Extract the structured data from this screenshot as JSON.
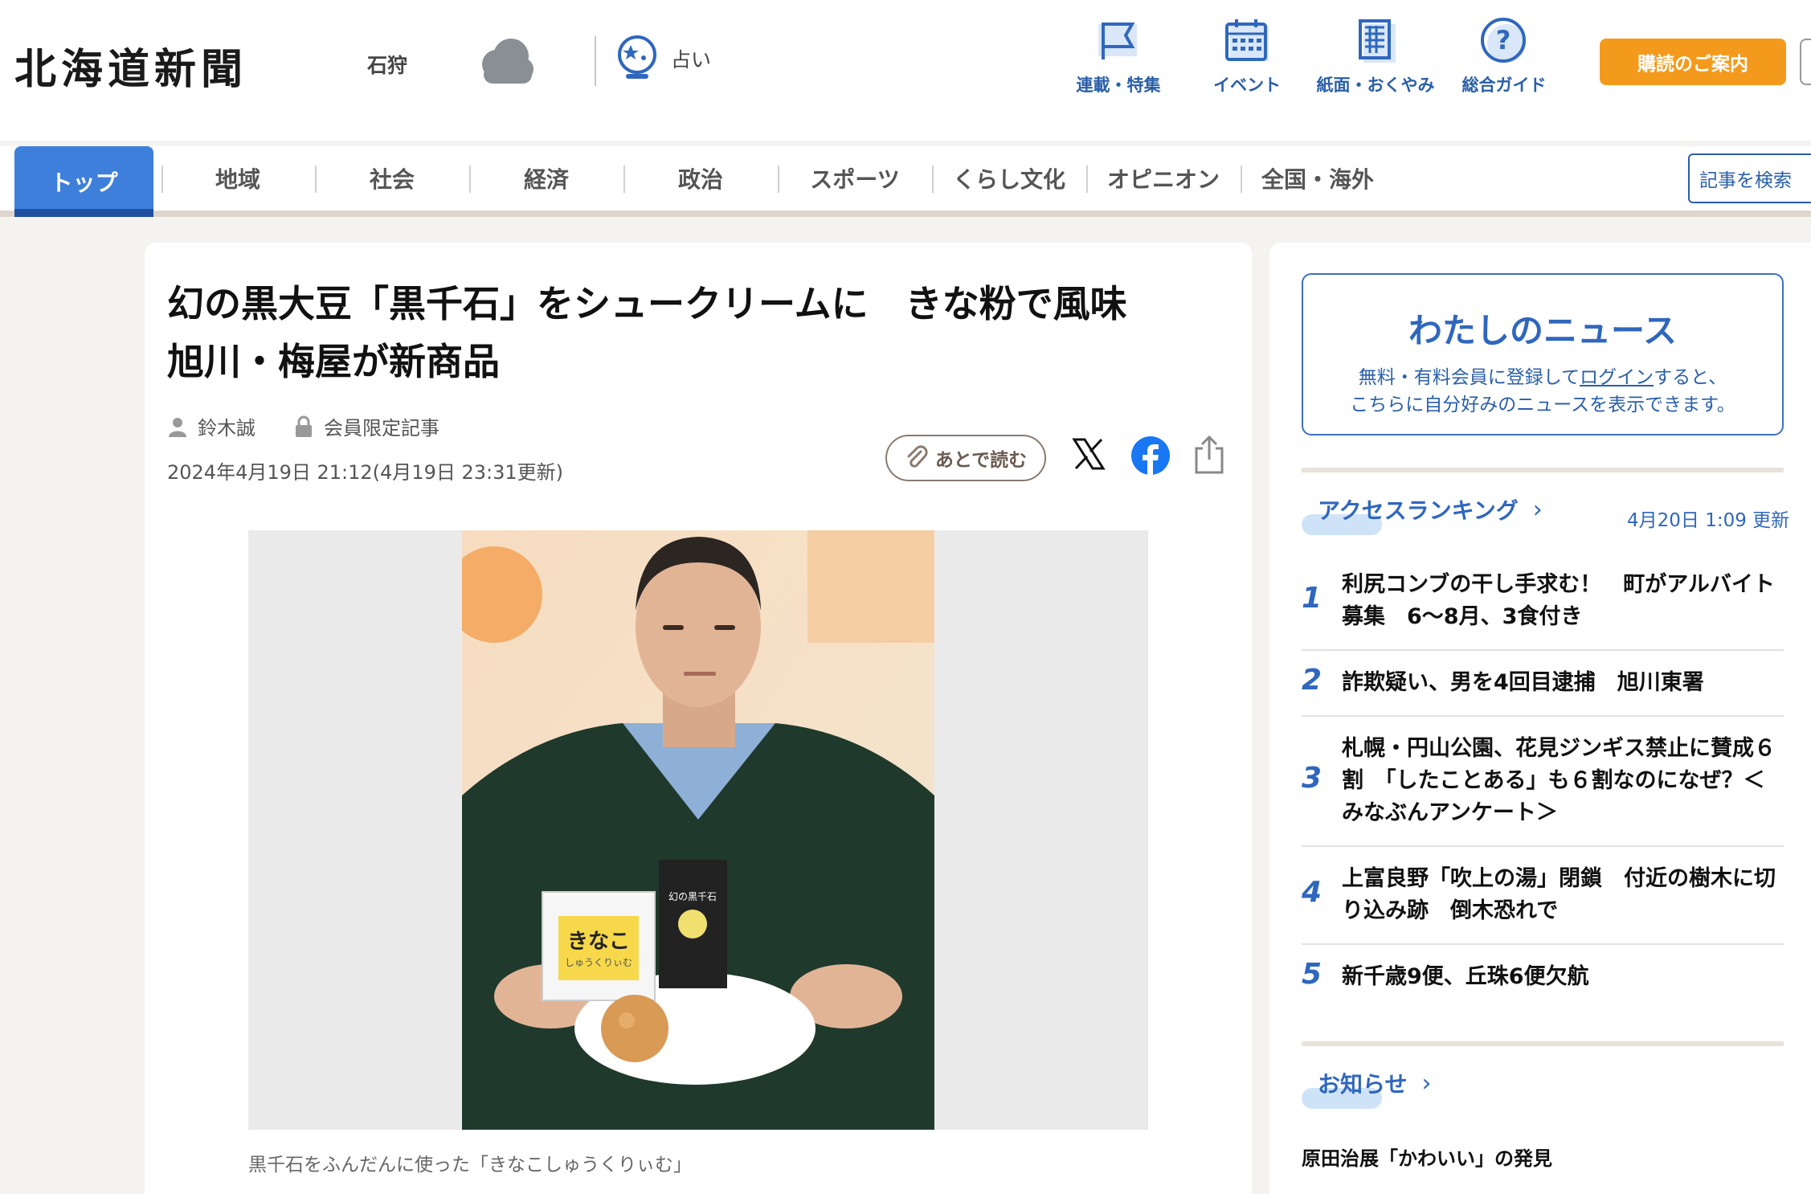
{
  "header": {
    "logo": "北海道新聞",
    "region": "石狩",
    "weather_icon": "cloud-icon",
    "fortune_label": "占い",
    "icons": [
      {
        "name": "flag-icon",
        "label": "連載・特集"
      },
      {
        "name": "calendar-icon",
        "label": "イベント"
      },
      {
        "name": "newspaper-icon",
        "label": "紙面・おくやみ"
      },
      {
        "name": "question-icon",
        "label": "総合ガイド"
      }
    ],
    "subscribe_label": "購読のご案内"
  },
  "nav": {
    "items": [
      "トップ",
      "地域",
      "社会",
      "経済",
      "政治",
      "スポーツ",
      "くらし文化",
      "オピニオン",
      "全国・海外"
    ],
    "active_index": 0,
    "search_label": "記事を検索"
  },
  "article": {
    "title_line1": "幻の黒大豆「黒千石」をシュークリームに　きな粉で風味",
    "title_line2": "旭川・梅屋が新商品",
    "author": "鈴木誠",
    "member_label": "会員限定記事",
    "date": "2024年4月19日 21:12(4月19日 23:31更新)",
    "read_later_label": "あとで読む",
    "photo_package_text": "きなこ",
    "photo_package_sub": "しゅうくりぃむ",
    "photo_bag_text": "幻の黒千石",
    "caption": "黒千石をふんだんに使った「きなこしゅうくりぃむ」"
  },
  "sidebar": {
    "my_news": {
      "heading": "わたしのニュース",
      "text_before_link": "無料・有料会員に登録して",
      "link": "ログイン",
      "text_after_link": "すると、",
      "line2": "こちらに自分好みのニュースを表示できます。"
    },
    "ranking": {
      "heading": "アクセスランキング",
      "updated": "4月20日 1:09 更新",
      "items": [
        {
          "rank": "1",
          "text": "利尻コンブの干し手求む！　町がアルバイト募集　6〜8月、3食付き"
        },
        {
          "rank": "2",
          "text": "詐欺疑い、男を4回目逮捕　旭川東署"
        },
        {
          "rank": "3",
          "text": "札幌・円山公園、花見ジンギス禁止に賛成６割　「したことある」も６割なのになぜ？＜みなぶんアンケート＞"
        },
        {
          "rank": "4",
          "text": "上富良野「吹上の湯」閉鎖　付近の樹木に切り込み跡　倒木恐れで"
        },
        {
          "rank": "5",
          "text": "新千歳9便、丘珠6便欠航"
        }
      ]
    },
    "notices": {
      "heading": "お知らせ",
      "first_item": "原田治展「かわいい」の発見"
    }
  },
  "colors": {
    "accent_blue": "#3e7fdc",
    "link_blue": "#2f67bd",
    "subscribe_orange": "#f39a1c"
  }
}
